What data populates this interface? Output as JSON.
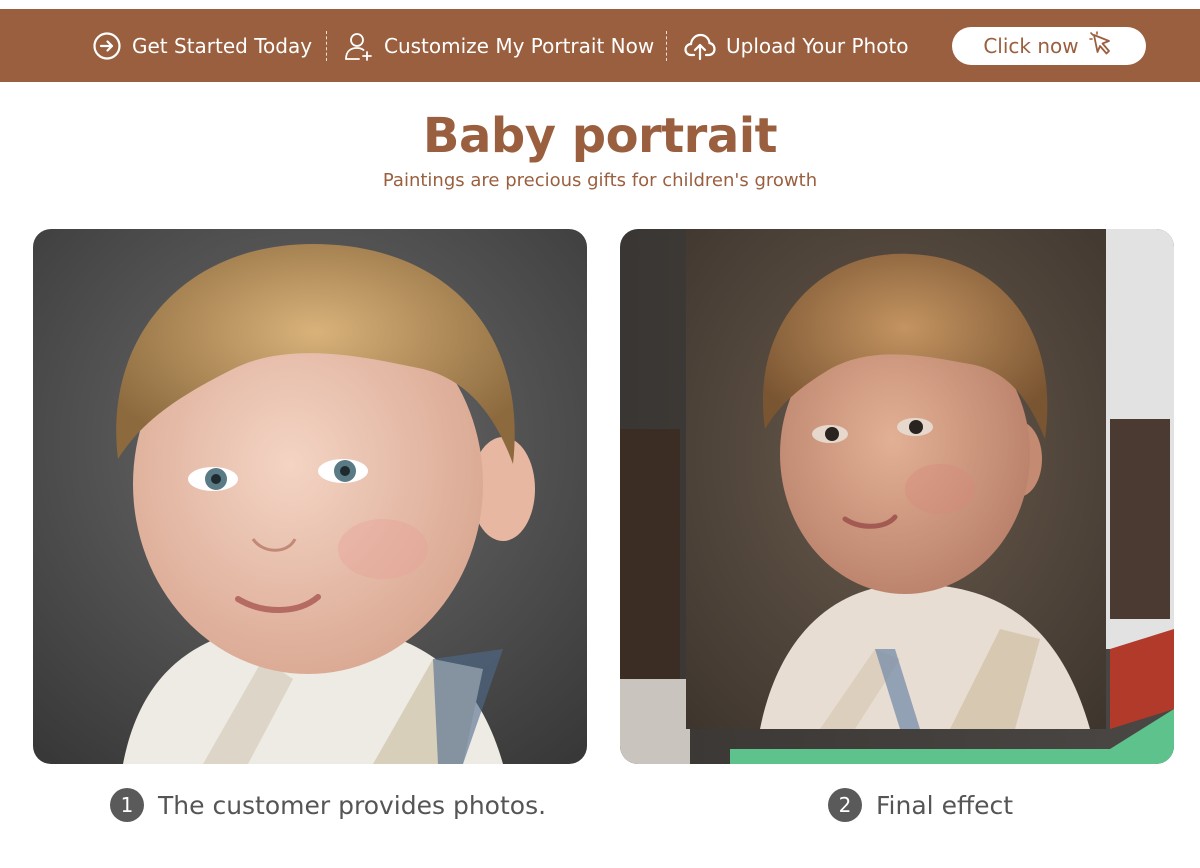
{
  "nav": {
    "items": [
      {
        "label": "Get Started Today",
        "icon": "arrow-circle-right-icon"
      },
      {
        "label": "Customize My Portrait Now",
        "icon": "user-plus-icon"
      },
      {
        "label": "Upload Your Photo",
        "icon": "cloud-upload-icon"
      }
    ],
    "cta_label": "Click now",
    "cta_icon": "pointer-click-icon"
  },
  "hero": {
    "title": "Baby portrait",
    "subtitle": "Paintings are precious gifts for children's growth"
  },
  "steps": [
    {
      "number": "1",
      "caption": "The customer provides photos."
    },
    {
      "number": "2",
      "caption": "Final effect"
    }
  ],
  "colors": {
    "brand": "#9a5f3f",
    "text_gray": "#555555",
    "badge_gray": "#5a5a5a"
  }
}
